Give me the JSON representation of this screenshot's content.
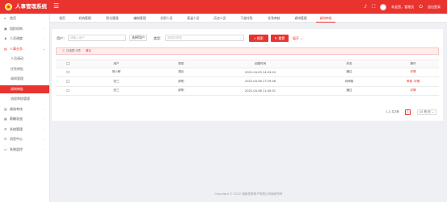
{
  "app": {
    "title": "人事管理系统"
  },
  "topbar": {
    "user": "欢迎您，管理员",
    "logout": "退出登录"
  },
  "sidebar": {
    "items": [
      {
        "label": "首页",
        "icon": "home-icon",
        "glyph": "⌂"
      },
      {
        "label": "组织机构",
        "icon": "org-icon",
        "glyph": "▣",
        "arrow": "›"
      },
      {
        "label": "人员调度",
        "icon": "person-icon",
        "glyph": "♟",
        "arrow": "›"
      },
      {
        "label": "人事业务",
        "icon": "business-icon",
        "glyph": "▤",
        "arrow": "⌄"
      },
      {
        "label": "人员调动"
      },
      {
        "label": "任免审批"
      },
      {
        "label": "调岗管理"
      },
      {
        "label": "调岗审批"
      },
      {
        "label": "流程审核管理"
      },
      {
        "label": "绩效考核",
        "icon": "chart-icon",
        "glyph": "▥",
        "arrow": "›"
      },
      {
        "label": "薪酬发放",
        "icon": "wallet-icon",
        "glyph": "▦",
        "arrow": "›"
      },
      {
        "label": "系统管理",
        "icon": "gear-icon",
        "glyph": "⚙",
        "arrow": "›"
      },
      {
        "label": "消息中心",
        "icon": "message-icon",
        "glyph": "✉",
        "arrow": "›"
      },
      {
        "label": "系统监控",
        "icon": "monitor-icon",
        "glyph": "▭",
        "arrow": "›"
      }
    ]
  },
  "tabs": [
    "首页",
    "机构管理",
    "职位管理",
    "编制管理",
    "任职人员",
    "离退人员",
    "历史人员",
    "干部任免",
    "任免审核",
    "调岗管理",
    "调岗审批"
  ],
  "filter": {
    "user_label": "用户：",
    "user_placeholder": "请输入用户",
    "applicant_label": "选择用户",
    "type_label": "类型：",
    "type_placeholder": "请选择类型",
    "search": "搜索",
    "reset": "重置",
    "expand": "展开"
  },
  "alert": {
    "text": "已选择 0项",
    "clear": "清空"
  },
  "table": {
    "headers": [
      "",
      "用户",
      "类型",
      "创建时间",
      "状态",
      "操作"
    ],
    "rows": [
      {
        "user": "测小郎",
        "type": "调出",
        "time": "2022-04-09 14:03:24",
        "status": "通过",
        "actions": [
          "详情"
        ]
      },
      {
        "user": "张三",
        "type": "辞职",
        "time": "2022-04-06 17:29:46",
        "status": "待审核",
        "actions": [
          "审核",
          "详情"
        ]
      },
      {
        "user": "张三",
        "type": "辞职",
        "time": "2022-04-06 11:40:51",
        "status": "通过",
        "actions": [
          "详情"
        ]
      }
    ]
  },
  "pager": {
    "range": "1-3 共3条",
    "prev": "‹",
    "page": "1",
    "next": "›",
    "size": "10 条/页"
  },
  "footer": "Copyright © 2022 湖南恒源电子有限公司版权所有"
}
